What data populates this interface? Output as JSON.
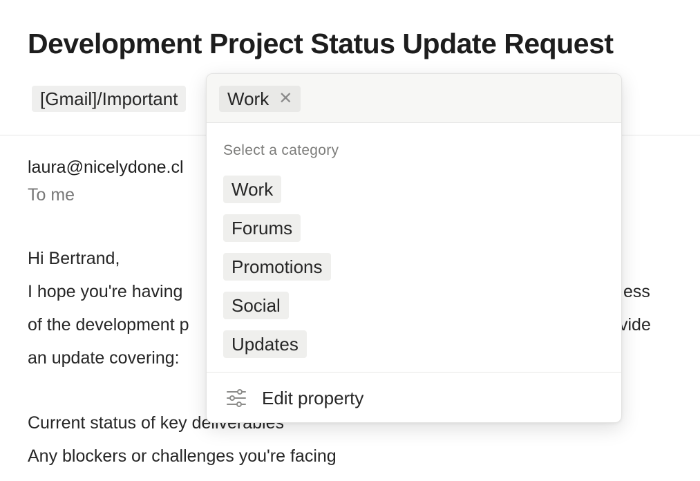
{
  "email": {
    "subject": "Development Project Status Update Request",
    "tags": [
      "[Gmail]/Important"
    ],
    "sender": "laura@nicelydone.cl",
    "recipient": "To me",
    "body_lines": [
      "Hi Bertrand,",
      "I hope you're having",
      "of the development p",
      "an update covering:",
      "Current status of key deliverables",
      "Any blockers or challenges you're facing"
    ],
    "body_fragments_right": [
      "ess",
      "vide"
    ]
  },
  "dropdown": {
    "selected": [
      {
        "label": "Work",
        "remove_icon": "close-icon"
      }
    ],
    "section_label": "Select a category",
    "options": [
      "Work",
      "Forums",
      "Promotions",
      "Social",
      "Updates"
    ],
    "edit_property": {
      "label": "Edit property",
      "icon": "sliders-icon"
    }
  }
}
